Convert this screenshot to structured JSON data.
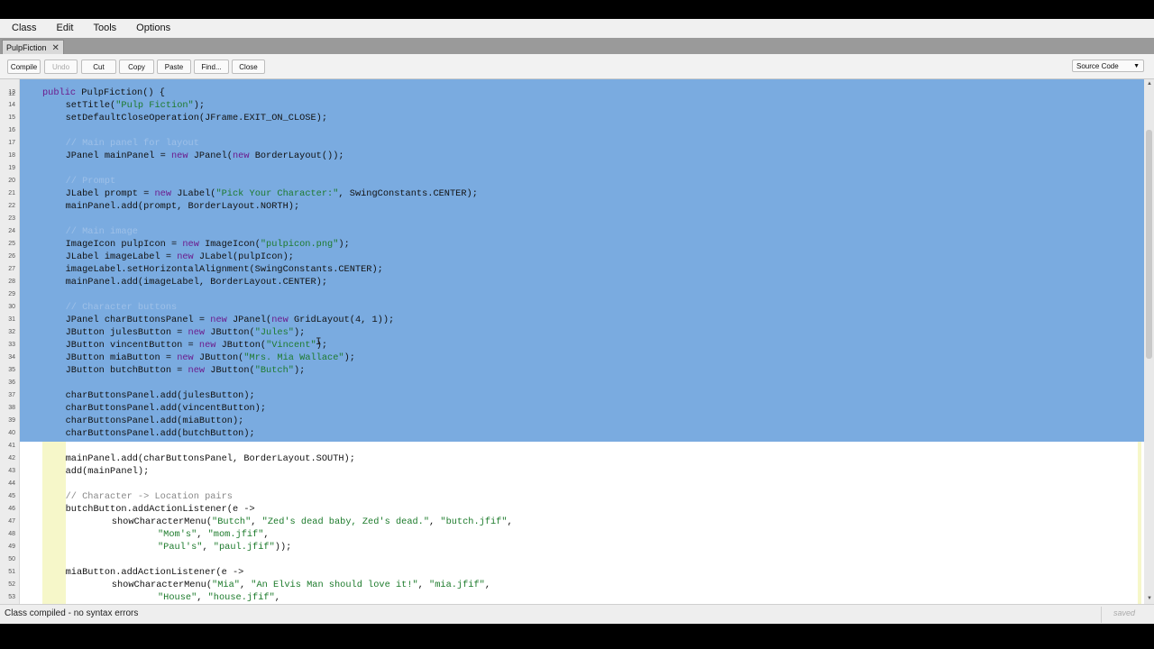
{
  "menu": [
    "Class",
    "Edit",
    "Tools",
    "Options"
  ],
  "tab": {
    "label": "PulpFiction",
    "close": "✕"
  },
  "toolbar": {
    "buttons": [
      {
        "label": "Compile",
        "enabled": true
      },
      {
        "label": "Undo",
        "enabled": false
      },
      {
        "label": "Cut",
        "enabled": true
      },
      {
        "label": "Copy",
        "enabled": true
      },
      {
        "label": "Paste",
        "enabled": true
      },
      {
        "label": "Find...",
        "enabled": true
      },
      {
        "label": "Close",
        "enabled": true
      }
    ],
    "view_select": "Source Code"
  },
  "editor": {
    "first_partial_line": "12",
    "lines": [
      {
        "n": "13",
        "indent": 0,
        "tokens": [
          [
            "kw",
            "public "
          ],
          [
            "",
            "PulpFiction() {"
          ]
        ]
      },
      {
        "n": "14",
        "indent": 1,
        "tokens": [
          [
            "",
            "setTitle("
          ],
          [
            "str",
            "\"Pulp Fiction\""
          ],
          [
            "",
            ");"
          ]
        ]
      },
      {
        "n": "15",
        "indent": 1,
        "tokens": [
          [
            "",
            "setDefaultCloseOperation(JFrame.EXIT_ON_CLOSE);"
          ]
        ]
      },
      {
        "n": "16",
        "indent": 0,
        "tokens": []
      },
      {
        "n": "17",
        "indent": 1,
        "tokens": [
          [
            "cmt",
            "// Main panel for layout"
          ]
        ]
      },
      {
        "n": "18",
        "indent": 1,
        "tokens": [
          [
            "",
            "JPanel mainPanel = "
          ],
          [
            "kw",
            "new "
          ],
          [
            "",
            "JPanel("
          ],
          [
            "kw",
            "new "
          ],
          [
            "",
            "BorderLayout());"
          ]
        ]
      },
      {
        "n": "19",
        "indent": 0,
        "tokens": []
      },
      {
        "n": "20",
        "indent": 1,
        "tokens": [
          [
            "cmt",
            "// Prompt"
          ]
        ]
      },
      {
        "n": "21",
        "indent": 1,
        "tokens": [
          [
            "",
            "JLabel prompt = "
          ],
          [
            "kw",
            "new "
          ],
          [
            "",
            "JLabel("
          ],
          [
            "str",
            "\"Pick Your Character:\""
          ],
          [
            "",
            ", SwingConstants.CENTER);"
          ]
        ]
      },
      {
        "n": "22",
        "indent": 1,
        "tokens": [
          [
            "",
            "mainPanel.add(prompt, BorderLayout.NORTH);"
          ]
        ]
      },
      {
        "n": "23",
        "indent": 0,
        "tokens": []
      },
      {
        "n": "24",
        "indent": 1,
        "tokens": [
          [
            "cmt",
            "// Main image"
          ]
        ]
      },
      {
        "n": "25",
        "indent": 1,
        "tokens": [
          [
            "",
            "ImageIcon pulpIcon = "
          ],
          [
            "kw",
            "new "
          ],
          [
            "",
            "ImageIcon("
          ],
          [
            "str",
            "\"pulpicon.png\""
          ],
          [
            "",
            ");"
          ]
        ]
      },
      {
        "n": "26",
        "indent": 1,
        "tokens": [
          [
            "",
            "JLabel imageLabel = "
          ],
          [
            "kw",
            "new "
          ],
          [
            "",
            "JLabel(pulpIcon);"
          ]
        ]
      },
      {
        "n": "27",
        "indent": 1,
        "tokens": [
          [
            "",
            "imageLabel.setHorizontalAlignment(SwingConstants.CENTER);"
          ]
        ]
      },
      {
        "n": "28",
        "indent": 1,
        "tokens": [
          [
            "",
            "mainPanel.add(imageLabel, BorderLayout.CENTER);"
          ]
        ]
      },
      {
        "n": "29",
        "indent": 0,
        "tokens": []
      },
      {
        "n": "30",
        "indent": 1,
        "tokens": [
          [
            "cmt",
            "// Character buttons"
          ]
        ]
      },
      {
        "n": "31",
        "indent": 1,
        "tokens": [
          [
            "",
            "JPanel charButtonsPanel = "
          ],
          [
            "kw",
            "new "
          ],
          [
            "",
            "JPanel("
          ],
          [
            "kw",
            "new "
          ],
          [
            "",
            "GridLayout(4, 1));"
          ]
        ]
      },
      {
        "n": "32",
        "indent": 1,
        "tokens": [
          [
            "",
            "JButton julesButton = "
          ],
          [
            "kw",
            "new "
          ],
          [
            "",
            "JButton("
          ],
          [
            "str",
            "\"Jules\""
          ],
          [
            "",
            ");"
          ]
        ]
      },
      {
        "n": "33",
        "indent": 1,
        "tokens": [
          [
            "",
            "JButton vincentButton = "
          ],
          [
            "kw",
            "new "
          ],
          [
            "",
            "JButton("
          ],
          [
            "str",
            "\"Vincent\""
          ],
          [
            "",
            ");"
          ]
        ]
      },
      {
        "n": "34",
        "indent": 1,
        "tokens": [
          [
            "",
            "JButton miaButton = "
          ],
          [
            "kw",
            "new "
          ],
          [
            "",
            "JButton("
          ],
          [
            "str",
            "\"Mrs. Mia Wallace\""
          ],
          [
            "",
            ");"
          ]
        ]
      },
      {
        "n": "35",
        "indent": 1,
        "tokens": [
          [
            "",
            "JButton butchButton = "
          ],
          [
            "kw",
            "new "
          ],
          [
            "",
            "JButton("
          ],
          [
            "str",
            "\"Butch\""
          ],
          [
            "",
            ");"
          ]
        ]
      },
      {
        "n": "36",
        "indent": 0,
        "tokens": []
      },
      {
        "n": "37",
        "indent": 1,
        "tokens": [
          [
            "",
            "charButtonsPanel.add(julesButton);"
          ]
        ]
      },
      {
        "n": "38",
        "indent": 1,
        "tokens": [
          [
            "",
            "charButtonsPanel.add(vincentButton);"
          ]
        ]
      },
      {
        "n": "39",
        "indent": 1,
        "tokens": [
          [
            "",
            "charButtonsPanel.add(miaButton);"
          ]
        ]
      },
      {
        "n": "40",
        "indent": 1,
        "tokens": [
          [
            "",
            "charButtonsPanel.add(butchButton);"
          ]
        ]
      },
      {
        "n": "41",
        "indent": 0,
        "tokens": []
      },
      {
        "n": "42",
        "indent": 1,
        "tokens": [
          [
            "",
            "mainPanel.add(charButtonsPanel, BorderLayout.SOUTH);"
          ]
        ]
      },
      {
        "n": "43",
        "indent": 1,
        "tokens": [
          [
            "",
            "add(mainPanel);"
          ]
        ]
      },
      {
        "n": "44",
        "indent": 0,
        "tokens": []
      },
      {
        "n": "45",
        "indent": 1,
        "tokens": [
          [
            "cmt",
            "// Character -> Location pairs"
          ]
        ]
      },
      {
        "n": "46",
        "indent": 1,
        "tokens": [
          [
            "",
            "butchButton.addActionListener(e ->"
          ]
        ]
      },
      {
        "n": "47",
        "indent": 3,
        "tokens": [
          [
            "",
            "showCharacterMenu("
          ],
          [
            "str",
            "\"Butch\""
          ],
          [
            "",
            ", "
          ],
          [
            "str",
            "\"Zed's dead baby, Zed's dead.\""
          ],
          [
            "",
            ", "
          ],
          [
            "str",
            "\"butch.jfif\""
          ],
          [
            "",
            ","
          ]
        ]
      },
      {
        "n": "48",
        "indent": 5,
        "tokens": [
          [
            "str",
            "\"Mom's\""
          ],
          [
            "",
            ", "
          ],
          [
            "str",
            "\"mom.jfif\""
          ],
          [
            "",
            ","
          ]
        ]
      },
      {
        "n": "49",
        "indent": 5,
        "tokens": [
          [
            "str",
            "\"Paul's\""
          ],
          [
            "",
            ", "
          ],
          [
            "str",
            "\"paul.jfif\""
          ],
          [
            "",
            "));"
          ]
        ]
      },
      {
        "n": "50",
        "indent": 0,
        "tokens": []
      },
      {
        "n": "51",
        "indent": 1,
        "tokens": [
          [
            "",
            "miaButton.addActionListener(e ->"
          ]
        ]
      },
      {
        "n": "52",
        "indent": 3,
        "tokens": [
          [
            "",
            "showCharacterMenu("
          ],
          [
            "str",
            "\"Mia\""
          ],
          [
            "",
            ", "
          ],
          [
            "str",
            "\"An Elvis Man should love it!\""
          ],
          [
            "",
            ", "
          ],
          [
            "str",
            "\"mia.jfif\""
          ],
          [
            "",
            ","
          ]
        ]
      },
      {
        "n": "53",
        "indent": 5,
        "tokens": [
          [
            "str",
            "\"House\""
          ],
          [
            "",
            ", "
          ],
          [
            "str",
            "\"house.jfif\""
          ],
          [
            "",
            ","
          ]
        ]
      }
    ]
  },
  "status": {
    "message": "Class compiled - no syntax errors",
    "saved": "saved"
  },
  "colors": {
    "selection": "#7aabe0",
    "keyword": "#6c1a8c",
    "string": "#1b7a2a",
    "scope": "#f6f7c9"
  }
}
